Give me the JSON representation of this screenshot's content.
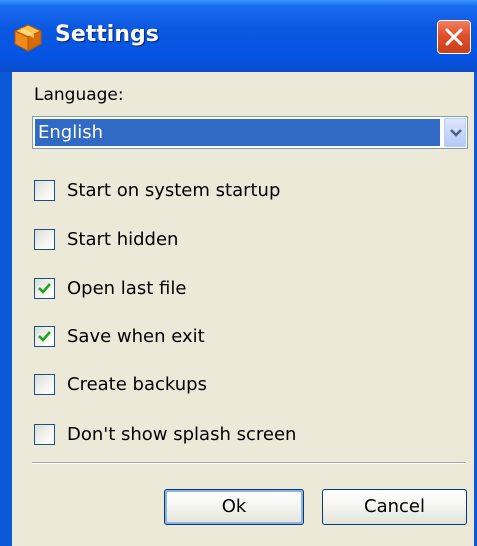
{
  "window": {
    "title": "Settings",
    "app_icon": "orange-box-icon",
    "close_icon": "close-icon"
  },
  "language": {
    "label": "Language:",
    "selected": "English"
  },
  "options": [
    {
      "label": "Start on system startup",
      "checked": false
    },
    {
      "label": "Start hidden",
      "checked": false
    },
    {
      "label": "Open last file",
      "checked": true
    },
    {
      "label": "Save when exit",
      "checked": true
    },
    {
      "label": "Create backups",
      "checked": false
    },
    {
      "label": "Don't show splash screen",
      "checked": false
    }
  ],
  "buttons": {
    "ok": "Ok",
    "cancel": "Cancel"
  },
  "colors": {
    "titlebar": "#0554e3",
    "selection": "#316ac5",
    "client": "#ece9d8",
    "close": "#e0502a",
    "check": "#21a121"
  }
}
